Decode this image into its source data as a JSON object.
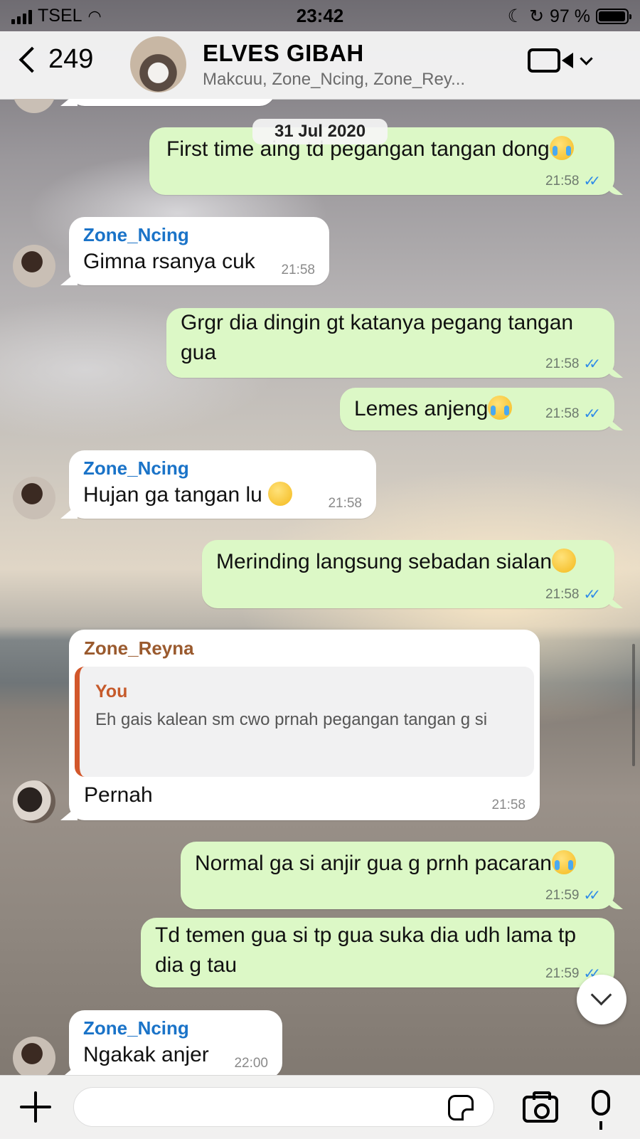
{
  "status_bar": {
    "carrier": "TSEL",
    "time": "23:42",
    "battery": "97 %"
  },
  "header": {
    "back_count": "249",
    "group_name": "ELVES GIBAH",
    "members": "Makcuu, Zone_Ncing, Zone_Rey..."
  },
  "date_chip": "31 Jul 2020",
  "messages": [
    {
      "dir": "out",
      "text": "First time aing td pegangan tangan dong",
      "emoji": "loudly-crying-face",
      "time": "21:58"
    },
    {
      "dir": "in",
      "sender": "Zone_Ncing",
      "text": "Gimna rsanya cuk",
      "time": "21:58"
    },
    {
      "dir": "out",
      "text": "Grgr dia dingin gt katanya pegang tangan gua",
      "time": "21:58"
    },
    {
      "dir": "out",
      "text": "Lemes anjeng",
      "emoji": "loudly-crying-face",
      "time": "21:58"
    },
    {
      "dir": "in",
      "sender": "Zone_Ncing",
      "text": "Hujan ga tangan lu",
      "emoji": "rolling-on-floor-laughing",
      "time": "21:58"
    },
    {
      "dir": "out",
      "text": "Merinding langsung sebadan sialan",
      "emoji": "sneezing-face",
      "time": "21:58"
    },
    {
      "dir": "in",
      "sender": "Zone_Reyna",
      "quote_name": "You",
      "quote_text": "Eh gais kalean sm cwo prnah pegangan tangan g si",
      "text": "Pernah",
      "time": "21:58"
    },
    {
      "dir": "out",
      "text": "Normal ga si anjir gua g prnh pacaran",
      "emoji": "loudly-crying-face",
      "time": "21:59"
    },
    {
      "dir": "out",
      "text": "Td temen gua si tp gua suka dia udh lama tp dia g tau",
      "time": "21:59"
    },
    {
      "dir": "in",
      "sender": "Zone_Ncing",
      "text": "Ngakak anjer",
      "time": "22:00"
    }
  ],
  "input": {
    "placeholder": ""
  },
  "colors": {
    "outgoing": "#dcf8c6",
    "incoming": "#ffffff",
    "sender_ncing": "#1a73c8",
    "sender_reyna": "#9a5a2e",
    "ticks": "#2f8be8"
  }
}
